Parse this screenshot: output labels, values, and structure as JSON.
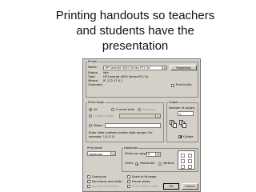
{
  "slide": {
    "title_lines": [
      "Printing handouts so teachers",
      "and students have the",
      "presentation"
    ]
  },
  "dialog": {
    "printer": {
      "group_label": "Printer",
      "name_label": "Name:",
      "name_value": "HP LaserJet 4050 Series PCL 5e",
      "properties_button": "Properties",
      "status_label": "Status:",
      "status_value": "Idle",
      "type_label": "Type:",
      "type_value": "HP LaserJet 4050 Series PCL 5e",
      "where_label": "Where:",
      "where_value": "IP_172.17.0.1",
      "comment_label": "Comment:",
      "print_to_file_label": "Print to file"
    },
    "print_range": {
      "group_label": "Print range",
      "all_label": "All",
      "current_slide_label": "Current slide",
      "selection_label": "Selection",
      "custom_show_label": "Custom Show:",
      "slides_label": "Slides:",
      "hint": [
        "Enter slide numbers and/or slide ranges. For",
        "example, 1,3,5-12"
      ]
    },
    "copies": {
      "group_label": "Copies",
      "number_label": "Number of copies:",
      "number_value": "1",
      "collate_label": "Collate"
    },
    "print_what": {
      "label": "Print what:",
      "value": "Handouts"
    },
    "handouts": {
      "group_label": "Handouts",
      "per_page_label": "Slides per page:",
      "per_page_value": "6",
      "order_label": "Order:",
      "horizontal_label": "Horizontal",
      "vertical_label": "Vertical"
    },
    "options": {
      "grayscale_label": "Grayscale",
      "pure_bw_label": "Pure black and white",
      "animations_label": "Include animations",
      "scale_label": "Scale to fit paper",
      "frame_label": "Frame slides",
      "hidden_label": "Print hidden slides"
    },
    "buttons": {
      "ok": "OK",
      "cancel": "Cancel"
    }
  }
}
